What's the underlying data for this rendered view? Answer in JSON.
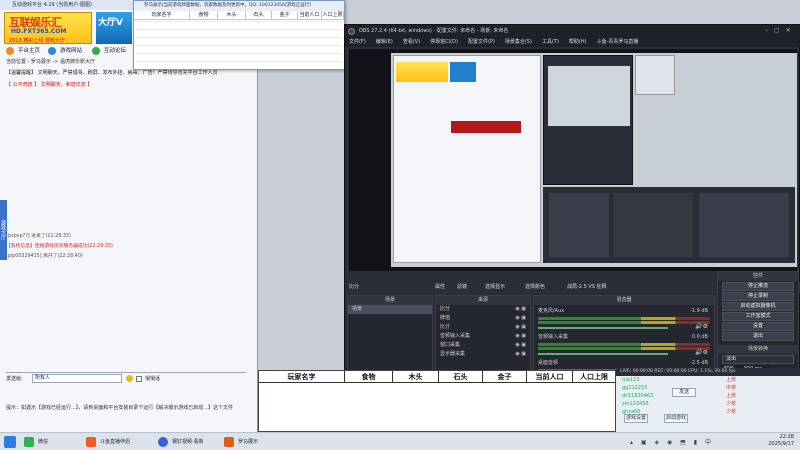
{
  "game_platform": {
    "title": "互动游戏平台 4.29 (当前用户:图图)",
    "logo": {
      "text": "互联娱乐汇",
      "url": "HD.FXT365.COM",
      "slogan": "2013 精彩上线 游戏大厅"
    },
    "banner": "大厅V",
    "nav": [
      "平台主页",
      "游戏网站",
      "互动论坛"
    ],
    "breadcrumb": "当前位置 : 罗马展示 -> 温虎牌乐新大厅",
    "notice": "【温馨提醒】 文明聊天，严禁谩骂、刷屏、发布外挂、病毒、广告！严禁诱导冒充平台工作人员",
    "slogan": "【 公平竞技 】 文明聊天，和谐交流 】",
    "side_tab": "游戏大厅",
    "chat": [
      {
        "text": "[pvpvp??] 进来了(22:28:33)",
        "highlight": false
      },
      {
        "text": "【系统信息】连接游戏房间服务器成功(22:28:33)",
        "highlight": true
      },
      {
        "text": "[pip00329415] 离开了(22:28:40)",
        "highlight": false
      }
    ],
    "send_to_label": "发送给:",
    "send_to_value": "所有人",
    "private_label": "悄悄话",
    "tip": "提示：如遇示【游戏已经运行...】，请到桌面和平台安装目录下运行【解决爆示游戏已启动...】这个文件"
  },
  "top_table": {
    "title": "罗马展示|当前游戏牌面数据，玩家数据及时更新中。QQ: 100123456[游戏正运行]",
    "columns": [
      "玩家名字",
      "食物",
      "木头",
      "石头",
      "金子",
      "当前人口",
      "人口上限"
    ]
  },
  "obs": {
    "title": "OBS 27.2.4 (64-bit, windows) - 配置文件: 未命名 - 场景: 未命名",
    "menu": [
      "文件(F)",
      "编辑(E)",
      "查看(V)",
      "停靠窗口(D)",
      "配置文件(P)",
      "场景集合(S)",
      "工具(T)",
      "帮助(H)",
      "斗鱼-青青罗马直播"
    ],
    "capture_label": "比分",
    "toolbar": [
      "属性",
      "滤镜",
      "选择显示",
      "选择颜色"
    ],
    "toolbar_value": "战局-2.5  VS  狂颗",
    "scenes": {
      "header": "场景",
      "items": [
        "场景"
      ]
    },
    "sources": {
      "header": "来源",
      "items": [
        "比分",
        "牌值",
        "比分",
        "音频输入采集",
        "窗口采集",
        "显示器采集"
      ]
    },
    "mixer": {
      "header": "混音器",
      "channels": [
        {
          "name": "麦克风/Aux",
          "db": "-1.9 dB",
          "level": 0.82
        },
        {
          "name": "音频输入采集",
          "db": "0.0 dB",
          "level": 0.64
        },
        {
          "name": "桌面音频",
          "db": "-2.5 dB",
          "level": 0.74
        }
      ]
    },
    "controls": {
      "header": "控件",
      "buttons": [
        "停止推流",
        "停止录制",
        "启动虚拟摄像机",
        "工作室模式",
        "设置",
        "退出"
      ]
    },
    "transitions": {
      "header": "场景转换",
      "type": "淡出",
      "duration_label": "时长",
      "duration": "300 ms"
    },
    "status": "LIVE: 00:00:00   REC: 00:00:00   CPU: 1.1%, 30.00 fps"
  },
  "bottom_table": {
    "columns": [
      "玩家名字",
      "食物",
      "木头",
      "石头",
      "金子",
      "当前人口",
      "人口上限"
    ]
  },
  "room_list": {
    "entries": [
      {
        "name": "rjia123",
        "status": "上校"
      },
      {
        "name": "gg112215",
        "status": "中将"
      },
      {
        "name": "dc51830463",
        "status": "上校"
      },
      {
        "name": "zm123456",
        "status": "少校"
      },
      {
        "name": "ghsx00",
        "status": "少校"
      }
    ],
    "send_button": "发送",
    "settings_button": "游戏设置",
    "start_button": "启动游戏"
  },
  "taskbar": {
    "items": [
      "微信",
      "斗鱼直播伴侣",
      "钢钉视频·看新",
      "罗马展示"
    ],
    "time": "22:28",
    "date": "2025/9/17"
  }
}
